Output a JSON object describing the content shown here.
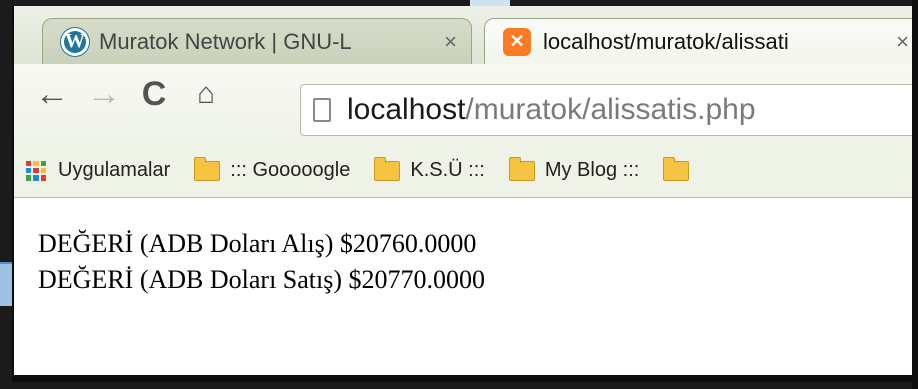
{
  "tabs": [
    {
      "title": "Muratok Network | GNU-L",
      "close": "×",
      "icon": "wordpress-icon",
      "active": false
    },
    {
      "title": "localhost/muratok/alissati",
      "close": "×",
      "icon": "xampp-icon",
      "active": true
    }
  ],
  "toolbar": {
    "back_icon": "←",
    "forward_icon": "→",
    "reload_icon": "C",
    "home_icon": "⌂"
  },
  "address": {
    "host": "localhost",
    "path": "/muratok/alissatis.php"
  },
  "bookmarks": {
    "apps_label": "Uygulamalar",
    "items": [
      "::: Gooooogle",
      "K.S.Ü :::",
      "My Blog :::",
      ""
    ]
  },
  "content": {
    "lines": [
      "DEĞERİ (ADB Doları Alış) $20760.0000",
      "DEĞERİ (ADB Doları Satış) $20770.0000"
    ]
  },
  "colors": {
    "wordpress": "#21759b",
    "xampp": "#fb7a24",
    "folder": "#f6c342"
  }
}
